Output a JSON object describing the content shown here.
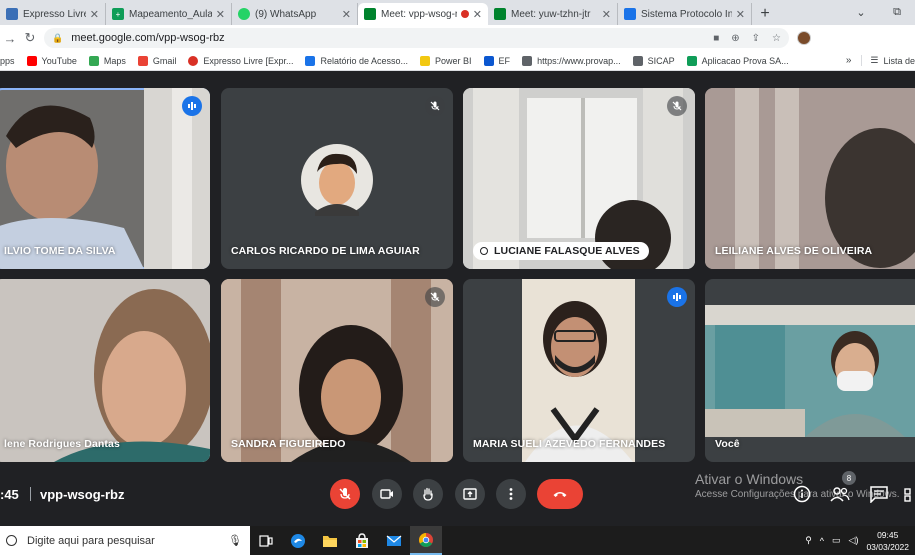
{
  "browser": {
    "tabs": [
      {
        "label": "Expresso Livre [Expres",
        "color": "#3b6fb6",
        "active": false
      },
      {
        "label": "Mapeamento_Aulas d",
        "color": "#0f9d58",
        "active": false
      },
      {
        "label": "(9) WhatsApp",
        "color": "#25d366",
        "active": false
      },
      {
        "label": "Meet: vpp-wsog-r",
        "color": "#00832d",
        "active": true,
        "recording": true
      },
      {
        "label": "Meet: yuw-tzhn-jtr",
        "color": "#00832d",
        "active": false
      },
      {
        "label": "Sistema Protocolo Inte",
        "color": "#1a73e8",
        "active": false
      }
    ],
    "new_tab": "+",
    "window_controls": [
      "⌄",
      "⧉"
    ],
    "url": "meet.google.com/vpp-wsog-rbz",
    "bookmarks": [
      {
        "label": "pps",
        "color": "#5f6368"
      },
      {
        "label": "YouTube",
        "color": "#ff0000"
      },
      {
        "label": "Maps",
        "color": "#34a853"
      },
      {
        "label": "Gmail",
        "color": "#ea4335"
      },
      {
        "label": "Expresso Livre [Expr...",
        "color": "#d93025"
      },
      {
        "label": "Relatório de Acesso...",
        "color": "#1a73e8"
      },
      {
        "label": "Power BI",
        "color": "#f2c811"
      },
      {
        "label": "EF",
        "color": "#0b57d0"
      },
      {
        "label": "https://www.provap...",
        "color": "#5f6368"
      },
      {
        "label": "SICAP",
        "color": "#5f6368"
      },
      {
        "label": "Aplicacao Prova SA...",
        "color": "#0f9d58"
      }
    ],
    "bookmarks_more": "»",
    "reading_list": "Lista de"
  },
  "meet": {
    "participants": [
      {
        "name": "ILVIO TOME DA SILVA",
        "mic": "speaking",
        "bg": "#6b6b6b"
      },
      {
        "name": "CARLOS RICARDO DE LIMA AGUIAR",
        "mic": "muted",
        "bg": "#3c4043",
        "avatar": true
      },
      {
        "name": "LUCIANE FALASQUE ALVES",
        "mic": "muted",
        "bg": "#cfcfcf",
        "pill": true
      },
      {
        "name": "LEILIANE ALVES DE OLIVEIRA",
        "mic": "none",
        "bg": "#9a8a8a"
      },
      {
        "name": "lene Rodrigues Dantas",
        "mic": "none",
        "bg": "#b8aaa0"
      },
      {
        "name": "SANDRA FIGUEIREDO",
        "mic": "muted",
        "bg": "#b79a88"
      },
      {
        "name": "MARIA SUELI AZEVEDO FERNANDES",
        "mic": "speaking",
        "bg": "#3c4043"
      },
      {
        "name": "Você",
        "mic": "none",
        "bg": "#3c4043"
      }
    ],
    "clock": ":45",
    "meeting_code": "vpp-wsog-rbz",
    "participants_count": "8"
  },
  "watermark": {
    "line1": "Ativar o Windows",
    "line2": "Acesse Configurações para ativar o Windows."
  },
  "taskbar": {
    "search_placeholder": "Digite aqui para pesquisar",
    "time": "09:45",
    "date": "03/03/2022"
  }
}
